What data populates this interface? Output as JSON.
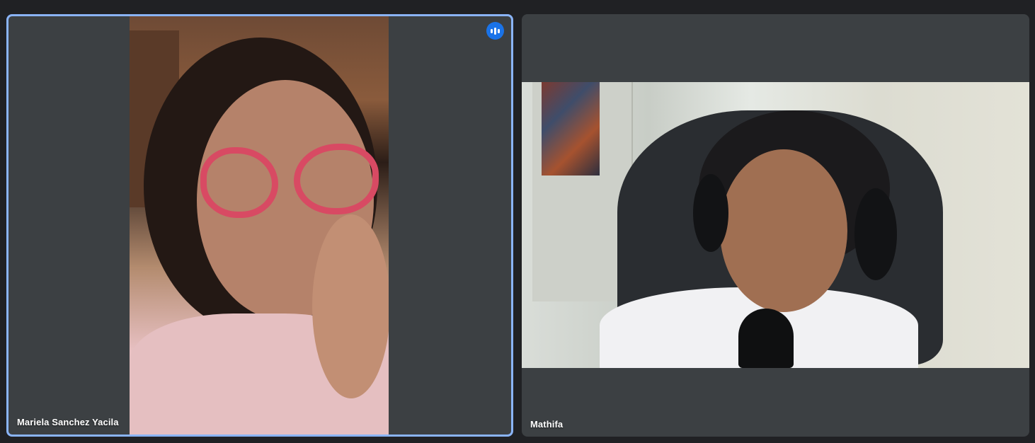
{
  "participants": [
    {
      "name": "Mariela Sanchez Yacila",
      "speaking": true,
      "active_border_color": "#8ab4f8",
      "indicator_color": "#1a73e8"
    },
    {
      "name": "Mathifa",
      "speaking": false
    }
  ],
  "icons": {
    "speaking": "audio-level-icon"
  },
  "colors": {
    "background": "#202124",
    "tile": "#3c4043"
  }
}
